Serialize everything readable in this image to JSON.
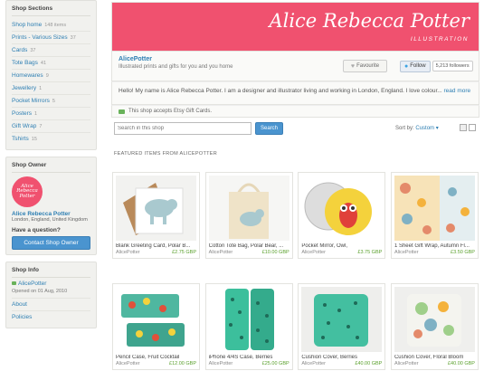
{
  "sidebar": {
    "sections_title": "Shop Sections",
    "sections": [
      {
        "name": "Shop home",
        "count": "148 items"
      },
      {
        "name": "Prints - Various Sizes",
        "count": "37"
      },
      {
        "name": "Cards",
        "count": "37"
      },
      {
        "name": "Tote Bags",
        "count": "41"
      },
      {
        "name": "Homewares",
        "count": "9"
      },
      {
        "name": "Jewellery",
        "count": "1"
      },
      {
        "name": "Pocket Mirrors",
        "count": "5"
      },
      {
        "name": "Posters",
        "count": "1"
      },
      {
        "name": "Gift Wrap",
        "count": "7"
      },
      {
        "name": "Tshirts",
        "count": "15"
      }
    ],
    "owner_title": "Shop Owner",
    "owner_logo_text": "Alice Rebecca Potter",
    "owner_name": "Alice Rebecca Potter",
    "owner_location": "London, England, United Kingdom",
    "question": "Have a question?",
    "contact_label": "Contact Shop Owner",
    "info_title": "Shop Info",
    "info_shop": "AlicePotter",
    "info_opened": "Opened on 01 Aug, 2010",
    "links": [
      "About",
      "Policies"
    ]
  },
  "banner": {
    "title": "Alice Rebecca Potter",
    "subtitle": "ILLUSTRATION"
  },
  "shop": {
    "name": "AlicePotter",
    "tagline": "Illustrated prints and gifts for you and you home",
    "favourite_label": "Favourite",
    "follow_label": "Follow",
    "followers": "5,213 followers",
    "about": "Hello! My name is Alice Rebecca Potter. I am a designer and illustrator living and working in London, England. I love colour...",
    "read_more": "read more",
    "gift_text": "This shop accepts Etsy Gift Cards."
  },
  "search": {
    "placeholder": "Search in this shop",
    "button": "Search",
    "sort_label": "Sort by:",
    "sort_value": "Custom"
  },
  "featured_label": "FEATURED ITEMS FROM ALICEPOTTER",
  "items_row1": [
    {
      "title": "Blank Greeting Card, Polar B...",
      "shop": "AlicePotter",
      "price": "£2.75 GBP"
    },
    {
      "title": "Cotton Tote Bag, Polar Bear, ...",
      "shop": "AlicePotter",
      "price": "£10.00 GBP"
    },
    {
      "title": "Pocket Mirror, Owl,",
      "shop": "AlicePotter",
      "price": "£3.75 GBP"
    },
    {
      "title": "1 Sheet Gift Wrap, Autumn Fl...",
      "shop": "AlicePotter",
      "price": "£3.50 GBP"
    }
  ],
  "items_row2": [
    {
      "title": "Pencil Case, Fruit Cocktail",
      "shop": "AlicePotter",
      "price": "£12.00 GBP"
    },
    {
      "title": "iPhone 4/4S Case, Berries",
      "shop": "AlicePotter",
      "price": "£25.00 GBP"
    },
    {
      "title": "Cushion Cover, Berries",
      "shop": "AlicePotter",
      "price": "£40.00 GBP"
    },
    {
      "title": "Cushion Cover, Floral Bloom",
      "shop": "AlicePotter",
      "price": "£40.00 GBP"
    }
  ],
  "colors": {
    "brand": "#f0516f",
    "link": "#2e7fb3",
    "button": "#4a94cf",
    "price": "#5aa02c"
  }
}
